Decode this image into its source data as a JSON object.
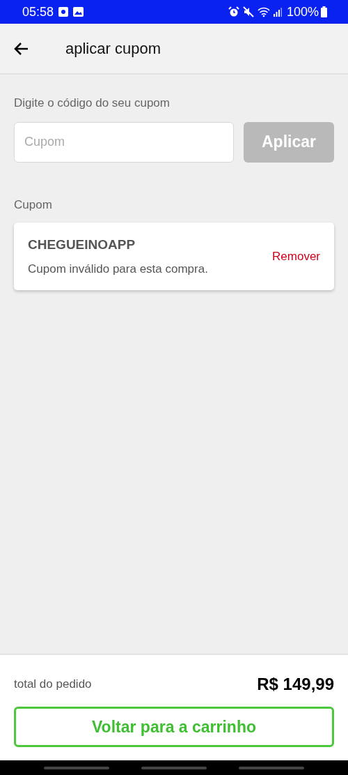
{
  "status_bar": {
    "time": "05:58",
    "battery": "100%"
  },
  "header": {
    "title": "aplicar cupom"
  },
  "coupon_form": {
    "label": "Digite o código do seu cupom",
    "placeholder": "Cupom",
    "apply_button": {
      "label": "Aplicar",
      "disabled": true
    }
  },
  "applied_coupon": {
    "section_label": "Cupom",
    "code": "CHEGUEINOAPP",
    "message": "Cupom inválido para esta compra.",
    "remove_label": "Remover"
  },
  "footer": {
    "total_label": "total do pedido",
    "total_value": "R$ 149,99",
    "back_button": "Voltar para a carrinho"
  }
}
